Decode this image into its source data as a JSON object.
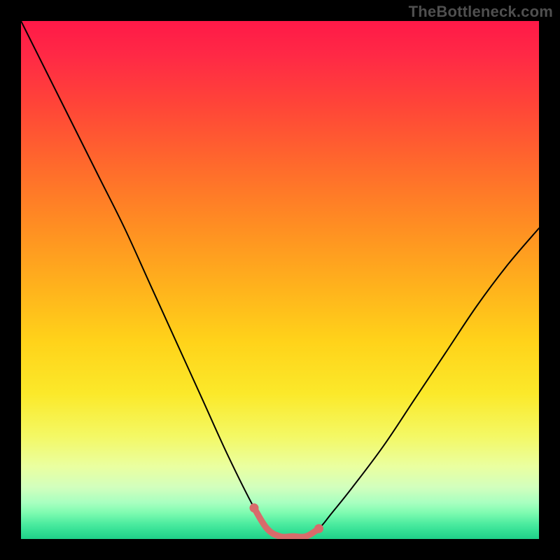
{
  "watermark": "TheBottleneck.com",
  "colors": {
    "page_bg": "#000000",
    "curve_stroke": "#000000",
    "marker_stroke": "#d86b6b",
    "marker_fill": "#d86b6b"
  },
  "chart_data": {
    "type": "line",
    "title": "",
    "xlabel": "",
    "ylabel": "",
    "xlim": [
      0,
      100
    ],
    "ylim": [
      0,
      100
    ],
    "grid": false,
    "legend": false,
    "series": [
      {
        "name": "bottleneck-curve",
        "x": [
          0,
          5,
          10,
          15,
          20,
          25,
          30,
          35,
          40,
          45,
          47.5,
          50,
          52.5,
          55,
          57.5,
          60,
          64,
          70,
          76,
          82,
          88,
          94,
          100
        ],
        "values": [
          100,
          90,
          80,
          70,
          60,
          49,
          38,
          27,
          16,
          6,
          2,
          0.5,
          0.5,
          0.5,
          2,
          5,
          10,
          18,
          27,
          36,
          45,
          53,
          60
        ]
      }
    ],
    "markers": {
      "name": "highlight-segment",
      "x": [
        45,
        47.5,
        50,
        52.5,
        55,
        57.5
      ],
      "values": [
        6,
        2,
        0.5,
        0.5,
        0.5,
        2
      ]
    },
    "gradient_stops": [
      {
        "pos": 0,
        "color": "#ff1948"
      },
      {
        "pos": 0.5,
        "color": "#ffb41c"
      },
      {
        "pos": 0.8,
        "color": "#f4f863"
      },
      {
        "pos": 1.0,
        "color": "#1fd088"
      }
    ]
  }
}
